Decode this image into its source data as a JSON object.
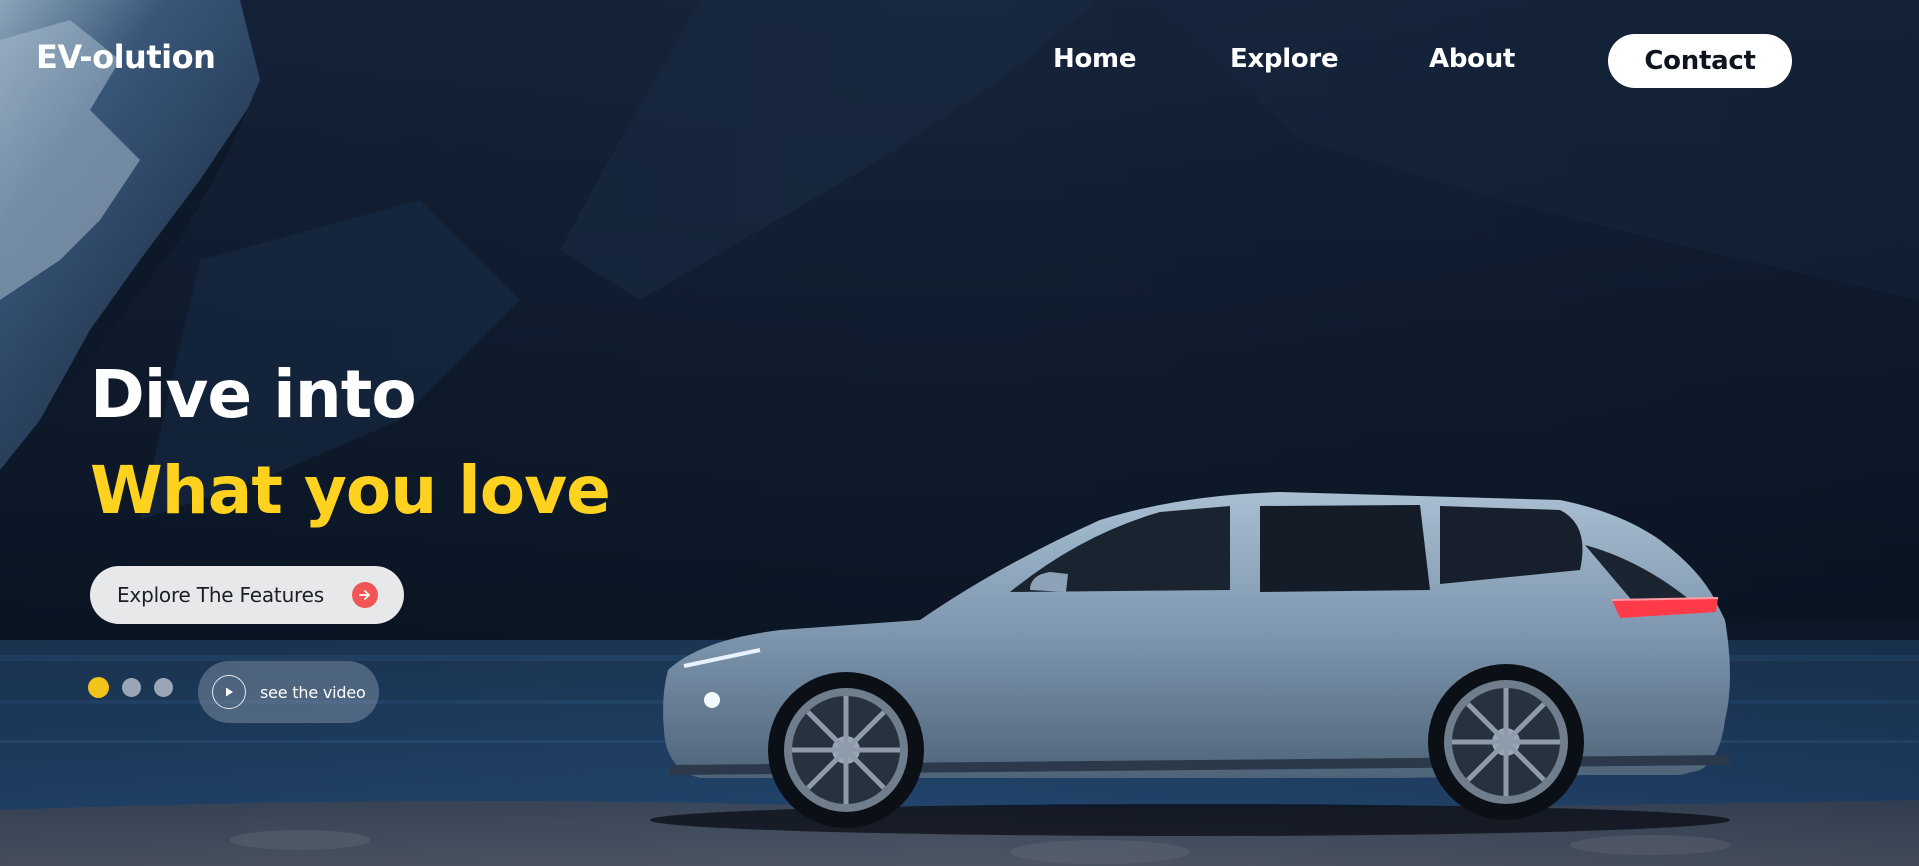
{
  "nav": {
    "logo": "EV-olution",
    "links": [
      {
        "label": "Home"
      },
      {
        "label": "Explore"
      },
      {
        "label": "About"
      }
    ],
    "contact_label": "Contact"
  },
  "hero": {
    "headline_line1": "Dive into",
    "headline_line2": "What you love",
    "cta_label": "Explore The Features",
    "video_label": "see the video",
    "slides": {
      "count": 3,
      "active": 0
    }
  },
  "icons": {
    "cta_icon": "arrow-right-icon",
    "video_icon": "play-icon"
  },
  "colors": {
    "accent_yellow": "#ffd21f",
    "cta_arrow_red": "#f25555",
    "slide_dot_active": "#f2c318",
    "slide_dot_inactive": "#9aa6b5"
  }
}
